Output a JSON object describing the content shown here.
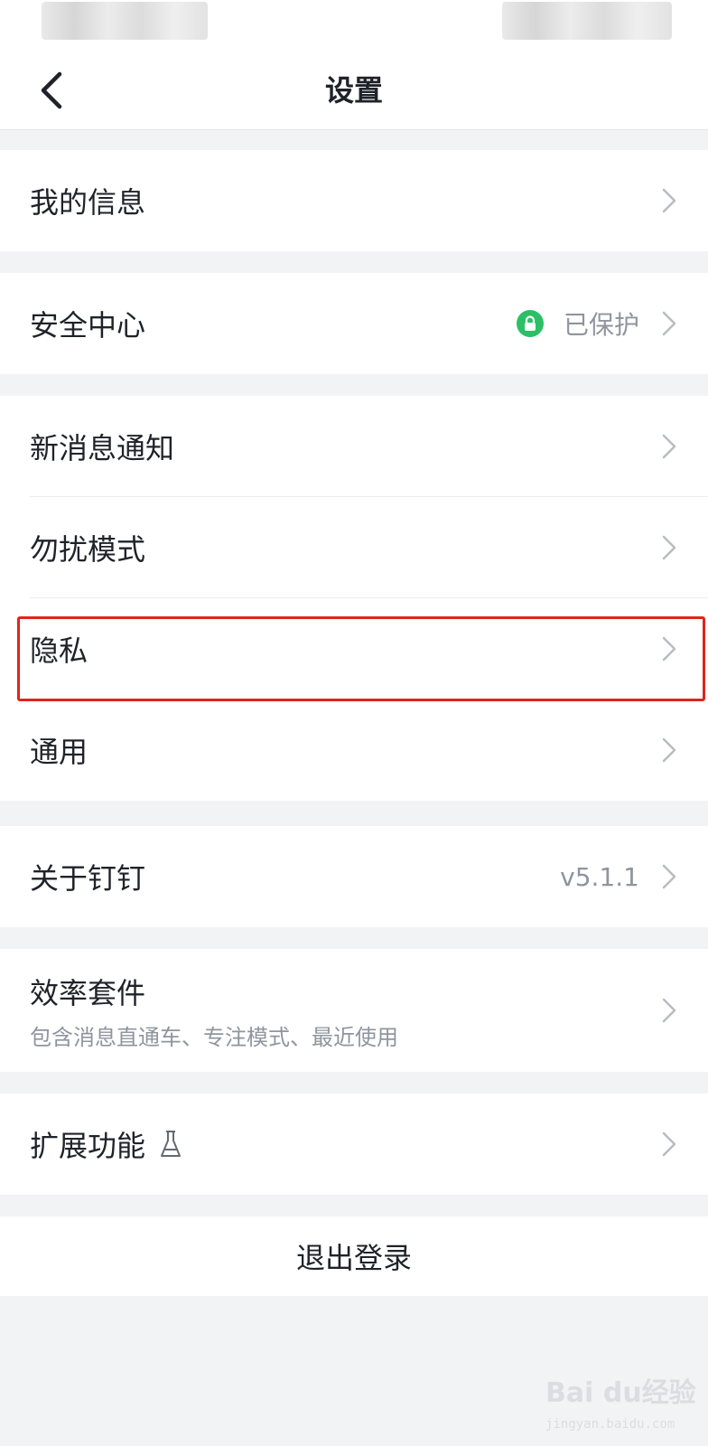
{
  "header": {
    "title": "设置"
  },
  "groups": {
    "my_info": {
      "label": "我的信息"
    },
    "security": {
      "label": "安全中心",
      "status": "已保护"
    },
    "notify": {
      "new_message": {
        "label": "新消息通知"
      },
      "dnd": {
        "label": "勿扰模式"
      },
      "privacy": {
        "label": "隐私"
      },
      "general": {
        "label": "通用"
      }
    },
    "about": {
      "label": "关于钉钉",
      "version": "v5.1.1"
    },
    "efficiency": {
      "label": "效率套件",
      "sub": "包含消息直通车、专注模式、最近使用"
    },
    "extensions": {
      "label": "扩展功能"
    }
  },
  "logout": {
    "label": "退出登录"
  },
  "watermark": {
    "logo": "Bai du经验",
    "url": "jingyan.baidu.com"
  },
  "colors": {
    "highlight": "#e0241c",
    "secure_badge": "#2bc066",
    "chevron": "#b8bcc2"
  }
}
